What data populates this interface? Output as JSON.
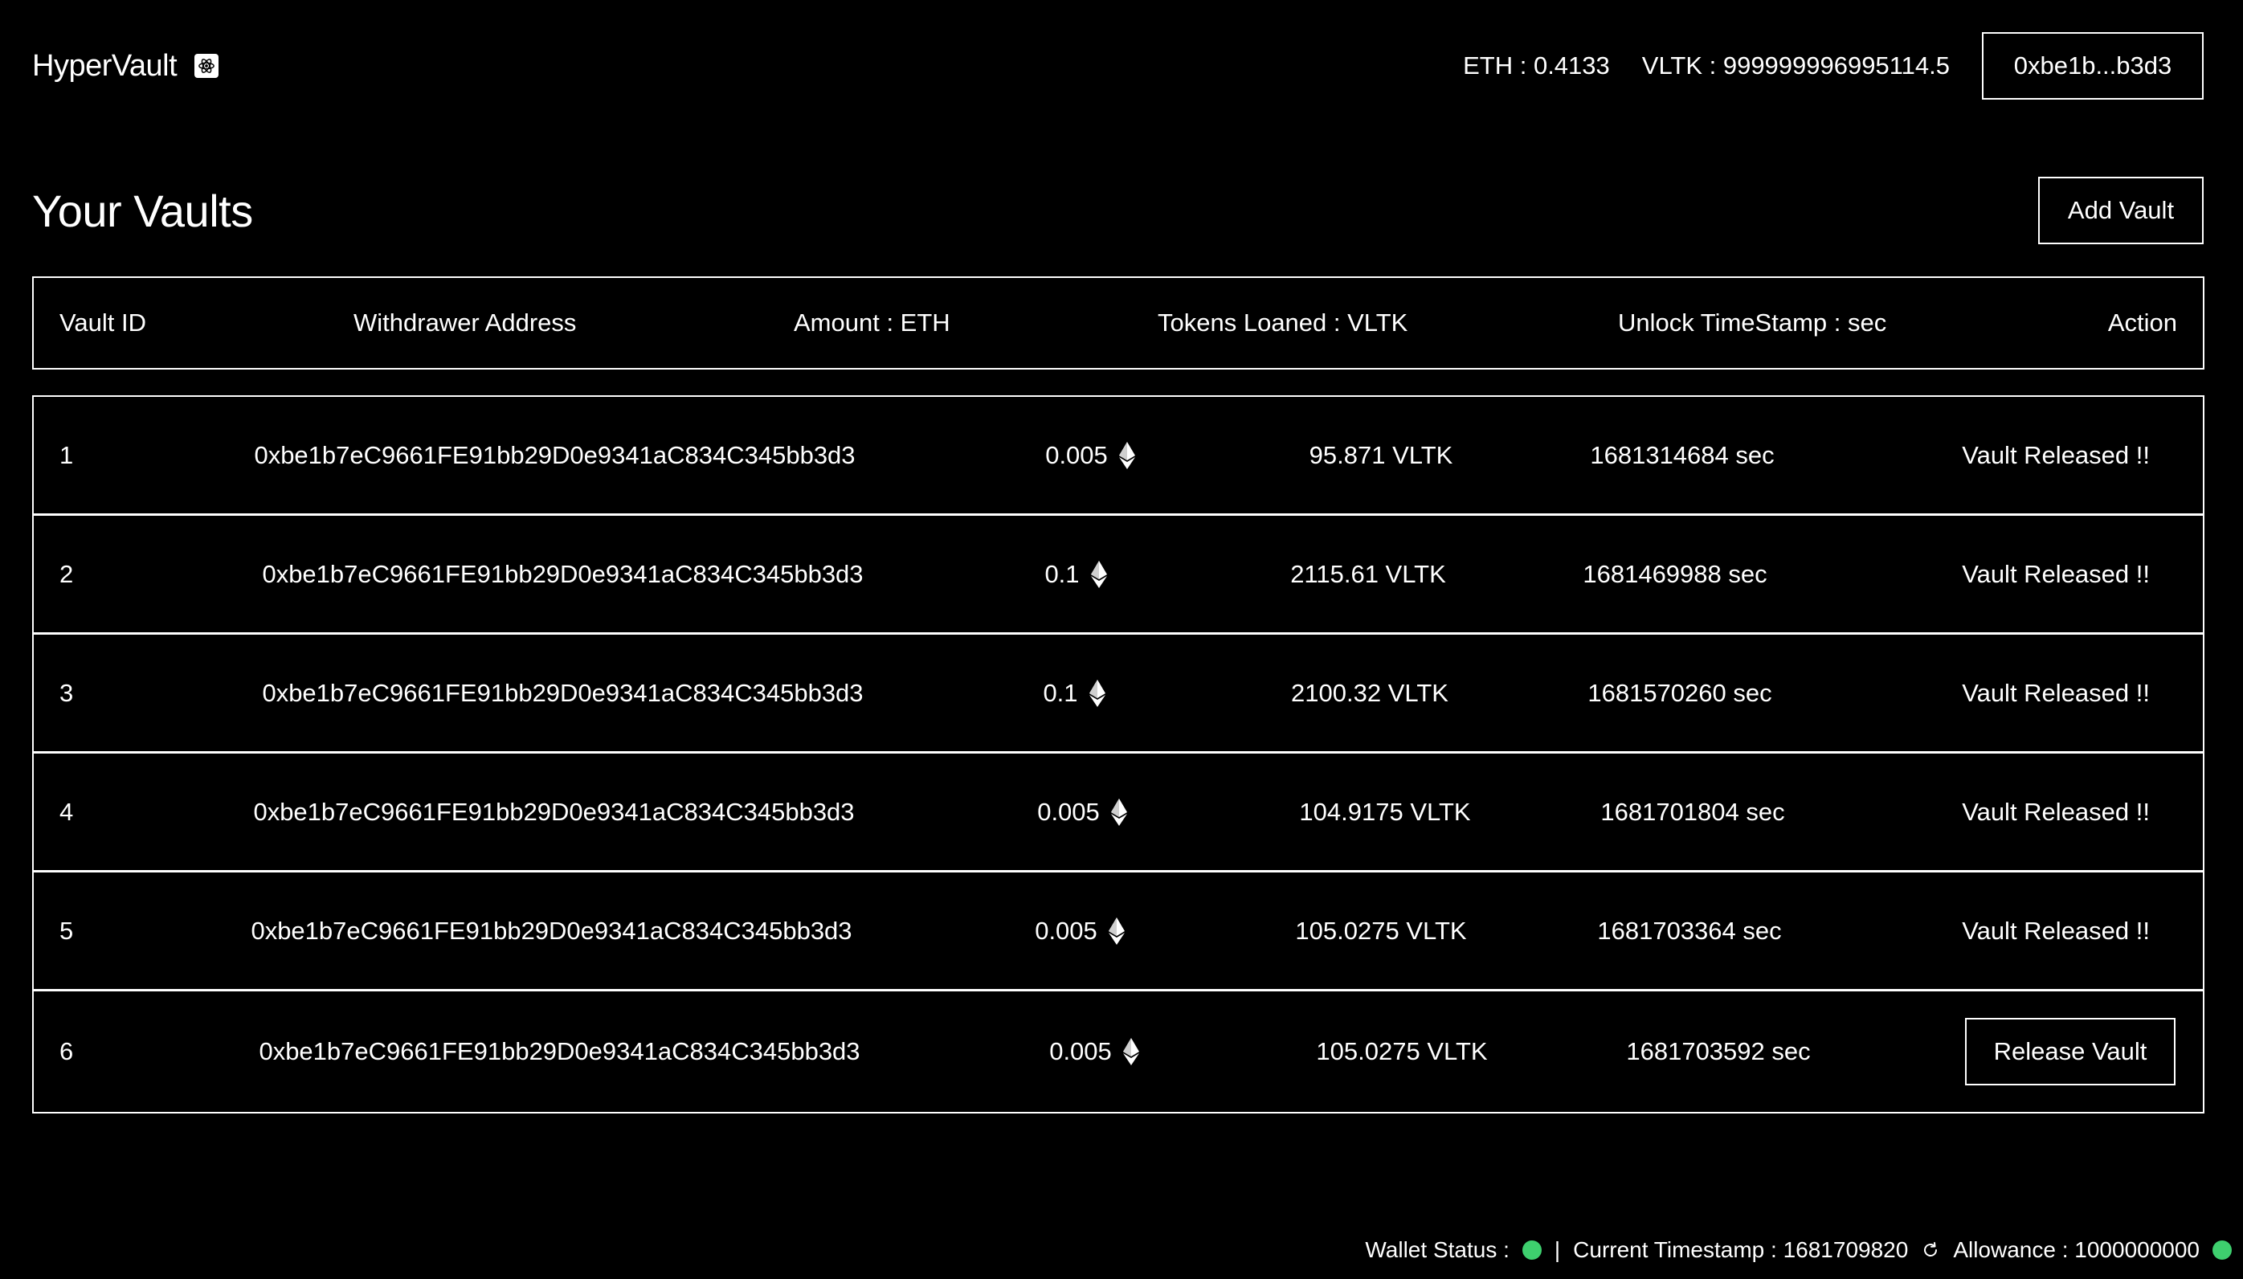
{
  "header": {
    "app_name": "HyperVault",
    "logo_icon": "react-atom-icon",
    "eth_balance": "ETH : 0.4133",
    "vltk_balance": "VLTK : 999999996995114.5",
    "account_label": "0xbe1b...b3d3"
  },
  "main": {
    "title": "Your Vaults",
    "add_button_label": "Add Vault"
  },
  "table": {
    "columns": [
      "Vault ID",
      "Withdrawer Address",
      "Amount : ETH",
      "Tokens Loaned : VLTK",
      "Unlock TimeStamp : sec",
      "Action"
    ],
    "rows": [
      {
        "id": "1",
        "address": "0xbe1b7eC9661FE91bb29D0e9341aC834C345bb3d3",
        "amount": "0.005",
        "tokens": "95.871 VLTK",
        "timestamp": "1681314684 sec",
        "action": "Vault Released !!",
        "action_type": "status"
      },
      {
        "id": "2",
        "address": "0xbe1b7eC9661FE91bb29D0e9341aC834C345bb3d3",
        "amount": "0.1",
        "tokens": "2115.61 VLTK",
        "timestamp": "1681469988 sec",
        "action": "Vault Released !!",
        "action_type": "status"
      },
      {
        "id": "3",
        "address": "0xbe1b7eC9661FE91bb29D0e9341aC834C345bb3d3",
        "amount": "0.1",
        "tokens": "2100.32 VLTK",
        "timestamp": "1681570260 sec",
        "action": "Vault Released !!",
        "action_type": "status"
      },
      {
        "id": "4",
        "address": "0xbe1b7eC9661FE91bb29D0e9341aC834C345bb3d3",
        "amount": "0.005",
        "tokens": "104.9175 VLTK",
        "timestamp": "1681701804 sec",
        "action": "Vault Released !!",
        "action_type": "status"
      },
      {
        "id": "5",
        "address": "0xbe1b7eC9661FE91bb29D0e9341aC834C345bb3d3",
        "amount": "0.005",
        "tokens": "105.0275 VLTK",
        "timestamp": "1681703364 sec",
        "action": "Vault Released !!",
        "action_type": "status"
      },
      {
        "id": "6",
        "address": "0xbe1b7eC9661FE91bb29D0e9341aC834C345bb3d3",
        "amount": "0.005",
        "tokens": "105.0275 VLTK",
        "timestamp": "1681703592 sec",
        "action": "Release Vault",
        "action_type": "button"
      }
    ],
    "amount_icon": "ethereum-icon"
  },
  "footer": {
    "wallet_status_label": "Wallet Status :",
    "separator": "|",
    "timestamp_label": "Current Timestamp : 1681709820",
    "refresh_icon": "refresh-icon",
    "allowance_label": "Allowance : 1000000000",
    "status_color": "#3ecf6e"
  },
  "colors": {
    "background": "#000000",
    "foreground": "#ffffff",
    "status_ok": "#3ecf6e"
  }
}
